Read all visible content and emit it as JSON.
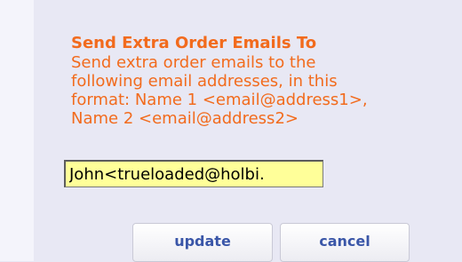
{
  "section": {
    "title": "Send Extra Order Emails To",
    "description_lines": [
      "Send extra order emails to the",
      "following email addresses, in this",
      "format: Name 1 <email@address1>,",
      "Name 2 <email@address2>"
    ]
  },
  "email_field": {
    "value": "John<trueloaded@holbi.",
    "placeholder": ""
  },
  "buttons": {
    "update_label": "update",
    "cancel_label": "cancel"
  },
  "colors": {
    "heading": "#f26b1d",
    "button_text": "#3a56a8",
    "input_bg": "#ffff99",
    "panel_bg": "#e8e8f4"
  }
}
